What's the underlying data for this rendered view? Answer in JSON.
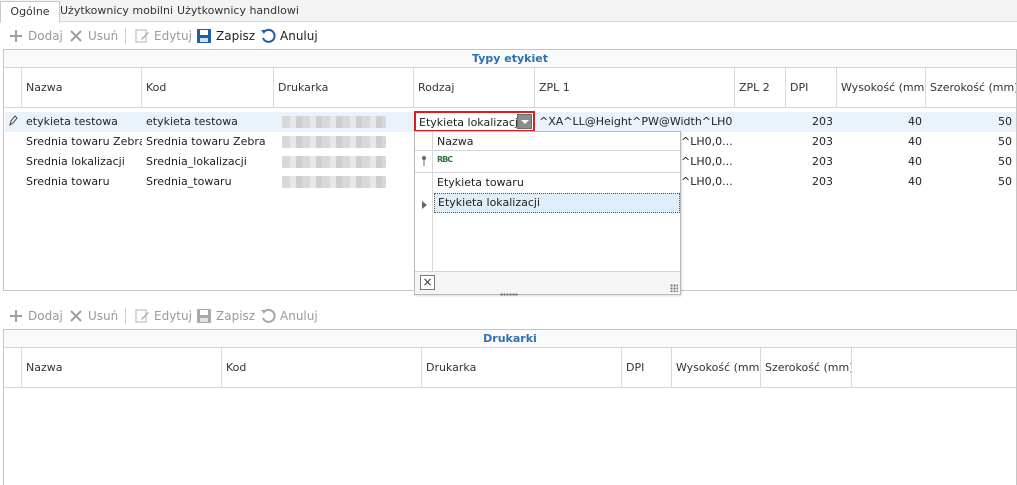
{
  "tabs": [
    {
      "label": "Ogólne",
      "active": true
    },
    {
      "label": "Użytkownicy mobilni",
      "active": false
    },
    {
      "label": "Użytkownicy handlowi",
      "active": false
    }
  ],
  "toolbar_top": {
    "add": "Dodaj",
    "delete": "Usuń",
    "edit": "Edytuj",
    "save": "Zapisz",
    "cancel": "Anuluj"
  },
  "toolbar_bottom": {
    "add": "Dodaj",
    "delete": "Usuń",
    "edit": "Edytuj",
    "save": "Zapisz",
    "cancel": "Anuluj"
  },
  "label_types": {
    "title": "Typy etykiet",
    "columns": [
      "Nazwa",
      "Kod",
      "Drukarka",
      "Rodzaj",
      "ZPL 1",
      "ZPL 2",
      "DPI",
      "Wysokość (mm)",
      "Szerokość (mm)"
    ],
    "rows": [
      {
        "name": "etykieta testowa",
        "code": "etykieta testowa",
        "kind": "Etykieta lokalizacji",
        "zpl1": "^XA^LL@Height^PW@Width^LH0,0...",
        "zpl2": "",
        "dpi": "203",
        "height": "40",
        "width": "50"
      },
      {
        "name": "Srednia towaru Zebra",
        "code": "Srednia towaru Zebra",
        "kind": "",
        "zpl1": "^LH0,0...",
        "zpl2": "",
        "dpi": "203",
        "height": "40",
        "width": "50"
      },
      {
        "name": "Srednia lokalizacji",
        "code": "Srednia_lokalizacji",
        "kind": "",
        "zpl1": "^LH0,0...",
        "zpl2": "",
        "dpi": "203",
        "height": "40",
        "width": "50"
      },
      {
        "name": "Srednia towaru",
        "code": "Srednia_towaru",
        "kind": "",
        "zpl1": "^LH0,0...",
        "zpl2": "",
        "dpi": "203",
        "height": "40",
        "width": "50"
      }
    ]
  },
  "kind_editor": {
    "value": "Etykieta lokalizacji",
    "popup_column": "Nazwa",
    "filter_icon_text": "RBC",
    "options": [
      "Etykieta towaru",
      "Etykieta lokalizacji"
    ],
    "selected_index": 1
  },
  "printers": {
    "title": "Drukarki",
    "columns": [
      "Nazwa",
      "Kod",
      "Drukarka",
      "DPI",
      "Wysokość (mm)",
      "Szerokość (mm)"
    ]
  },
  "icons": {
    "add": "plus-icon",
    "delete": "x-icon",
    "edit": "pencil-icon",
    "save": "floppy-disk-icon",
    "cancel": "undo-icon",
    "row_edit": "pencil-icon",
    "filter_pin": "pin-icon",
    "filter_type": "text-filter-icon",
    "row_indicator": "triangle-right-icon",
    "close": "close-icon",
    "resize": "resize-grip-icon"
  },
  "colors": {
    "accent": "#2e6fb5",
    "save": "#1f5fa8",
    "editor_border": "#d81e1e",
    "selection": "#eaf3fb"
  }
}
